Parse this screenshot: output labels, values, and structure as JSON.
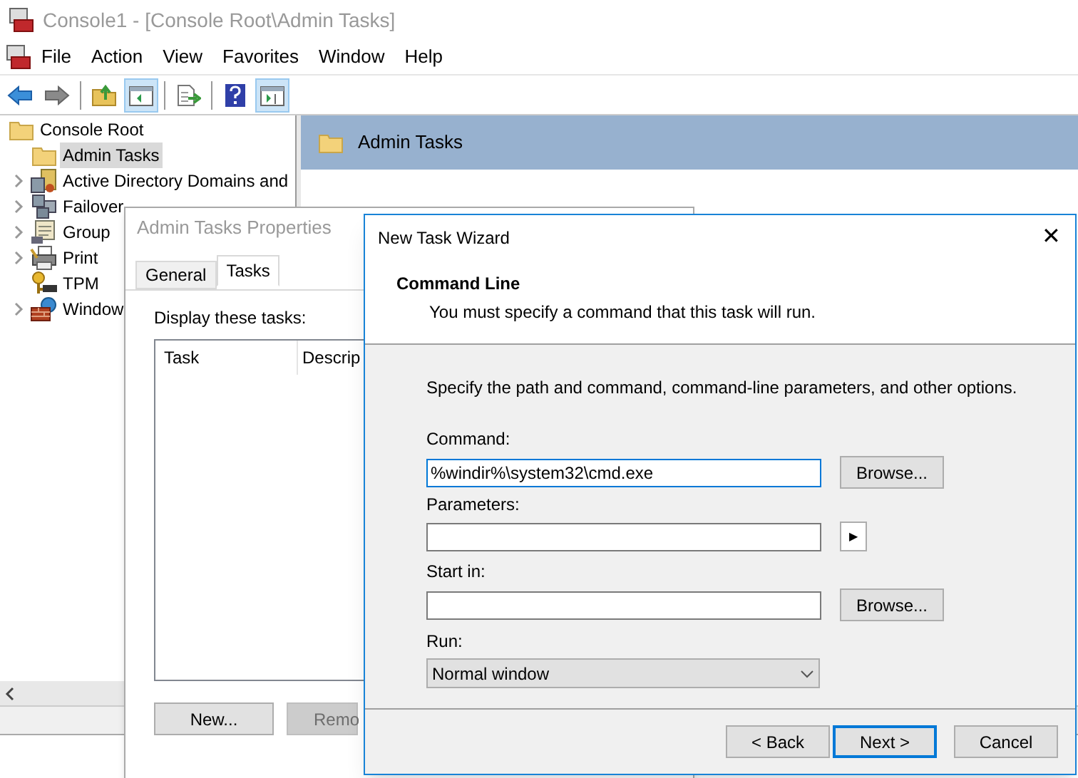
{
  "window": {
    "title": "Console1 - [Console Root\\Admin Tasks]",
    "active": false
  },
  "menu": [
    "File",
    "Action",
    "View",
    "Favorites",
    "Window",
    "Help"
  ],
  "toolbar": [
    {
      "kind": "back",
      "pressed": false
    },
    {
      "kind": "forward",
      "pressed": false
    },
    {
      "kind": "up",
      "pressed": false
    },
    {
      "kind": "tree",
      "pressed": true
    },
    {
      "kind": "export",
      "pressed": false
    },
    {
      "kind": "help",
      "pressed": false
    },
    {
      "kind": "pane",
      "pressed": true
    }
  ],
  "tree": [
    {
      "label": "Console Root",
      "kind": "folder",
      "selected": false,
      "children": [
        {
          "label": "Admin Tasks",
          "kind": "folder",
          "selected": true
        },
        {
          "label": "Active Directory Domains and",
          "kind": "domains",
          "selected": false,
          "expandable": true
        },
        {
          "label": "Failover",
          "kind": "cluster",
          "selected": false,
          "expandable": true
        },
        {
          "label": "Group",
          "kind": "policy",
          "selected": false,
          "expandable": true
        },
        {
          "label": "Print",
          "kind": "printer",
          "selected": false,
          "expandable": true
        },
        {
          "label": "TPM",
          "kind": "key",
          "selected": false
        },
        {
          "label": "Window",
          "kind": "firewall",
          "selected": false,
          "expandable": true
        }
      ]
    }
  ],
  "result_pane": {
    "header": "Admin Tasks"
  },
  "properties_dialog": {
    "title": "Admin Tasks Properties",
    "tabs": [
      {
        "label": "General",
        "selected": false
      },
      {
        "label": "Tasks",
        "selected": true
      }
    ],
    "list_label": "Display these tasks:",
    "columns": [
      "Task",
      "Descrip"
    ],
    "buttons": [
      {
        "label": "New...",
        "disabled": false
      },
      {
        "label": "Remo",
        "disabled": true
      }
    ]
  },
  "wizard": {
    "title": "New Task Wizard",
    "close": "✕",
    "heading": "Command Line",
    "subheading": "You must specify a command that this task will run.",
    "instructions": "Specify the path and command, command-line parameters, and other options.",
    "command": {
      "label": "Command:",
      "value": "%windir%\\system32\\cmd.exe",
      "focused": true,
      "button": "Browse..."
    },
    "parameters": {
      "label": "Parameters:",
      "arrow": "▶"
    },
    "start_in": {
      "label": "Start in:",
      "button": "Browse..."
    },
    "run": {
      "label": "Run:",
      "value": "Normal window"
    },
    "buttons": [
      {
        "label": "< Back",
        "default": false
      },
      {
        "label": "Next >",
        "default": true
      },
      {
        "label": "Cancel",
        "default": false
      }
    ]
  }
}
